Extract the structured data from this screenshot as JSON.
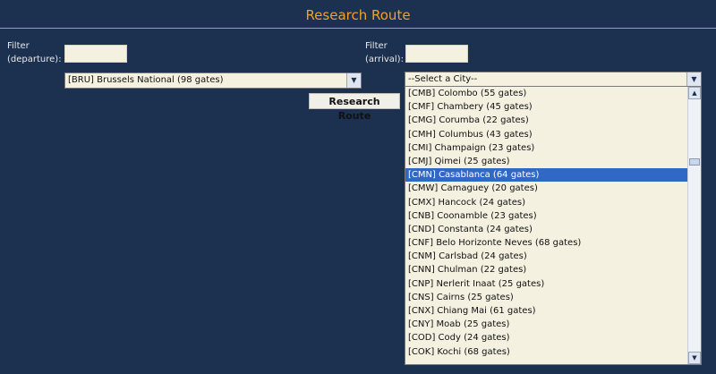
{
  "header": {
    "title": "Research Route"
  },
  "departure": {
    "filter_label_line1": "Filter",
    "filter_label_line2": "(departure):",
    "filter_value": "",
    "selected": "[BRU] Brussels National (98 gates)"
  },
  "arrival": {
    "filter_label_line1": "Filter",
    "filter_label_line2": "(arrival):",
    "filter_value": "",
    "selected": "--Select a City--",
    "options": [
      "[CMB] Colombo (55 gates)",
      "[CMF] Chambery (45 gates)",
      "[CMG] Corumba (22 gates)",
      "[CMH] Columbus (43 gates)",
      "[CMI] Champaign (23 gates)",
      "[CMJ] Qimei (25 gates)",
      "[CMN] Casablanca (64 gates)",
      "[CMW] Camaguey (20 gates)",
      "[CMX] Hancock (24 gates)",
      "[CNB] Coonamble (23 gates)",
      "[CND] Constanta (24 gates)",
      "[CNF] Belo Horizonte Neves (68 gates)",
      "[CNM] Carlsbad (24 gates)",
      "[CNN] Chulman (22 gates)",
      "[CNP] Nerlerit Inaat (25 gates)",
      "[CNS] Cairns (25 gates)",
      "[CNX] Chiang Mai (61 gates)",
      "[CNY] Moab (25 gates)",
      "[COD] Cody (24 gates)",
      "[COK] Kochi (68 gates)"
    ],
    "highlighted_index": 6
  },
  "actions": {
    "submit_label": "Research Route"
  },
  "icons": {
    "dropdown_arrow": "chevron-down-icon",
    "scroll_up": "chevron-up-icon",
    "scroll_down": "chevron-down-icon"
  },
  "colors": {
    "background": "#1c3150",
    "title": "#f0a030",
    "highlight": "#3168c6",
    "field": "#f4f1e1"
  }
}
